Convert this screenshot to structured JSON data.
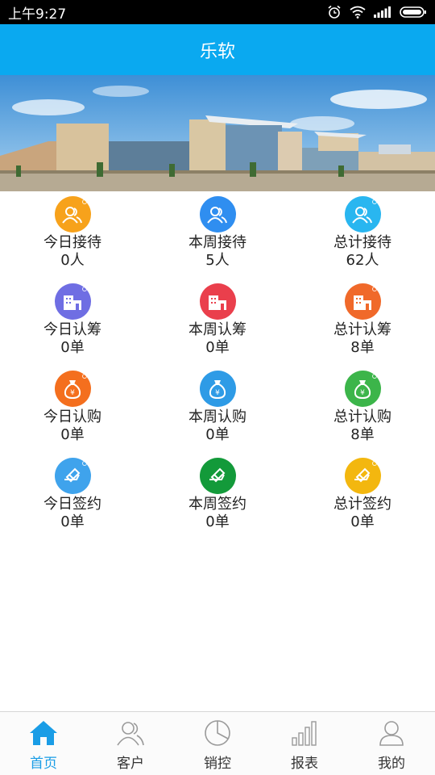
{
  "status_bar": {
    "time": "上午9:27"
  },
  "app_bar": {
    "title": "乐软"
  },
  "colors": {
    "primary": "#0aa9f0",
    "nav_active": "#1a9de6"
  },
  "stats": [
    [
      {
        "icon": "reception-icon",
        "color": "#f7a21b",
        "label": "今日接待",
        "value": "0人"
      },
      {
        "icon": "reception-icon",
        "color": "#2f8ef0",
        "label": "本周接待",
        "value": "5人"
      },
      {
        "icon": "reception-icon",
        "color": "#29b6f0",
        "label": "总计接待",
        "value": "62人"
      }
    ],
    [
      {
        "icon": "building-icon",
        "color": "#6f6ee3",
        "label": "今日认筹",
        "value": "0单"
      },
      {
        "icon": "building-icon",
        "color": "#ea3f4c",
        "label": "本周认筹",
        "value": "0单"
      },
      {
        "icon": "building-icon",
        "color": "#f0692a",
        "label": "总计认筹",
        "value": "8单"
      }
    ],
    [
      {
        "icon": "money-bag-icon",
        "color": "#f46f1e",
        "label": "今日认购",
        "value": "0单"
      },
      {
        "icon": "money-bag-icon",
        "color": "#2e9be6",
        "label": "本周认购",
        "value": "0单"
      },
      {
        "icon": "money-bag-icon",
        "color": "#3cb54a",
        "label": "总计认购",
        "value": "8单"
      }
    ],
    [
      {
        "icon": "signing-icon",
        "color": "#3fa3ec",
        "label": "今日签约",
        "value": "0单"
      },
      {
        "icon": "signing-icon",
        "color": "#139a3a",
        "label": "本周签约",
        "value": "0单"
      },
      {
        "icon": "signing-icon",
        "color": "#f3b70f",
        "label": "总计签约",
        "value": "0单"
      }
    ]
  ],
  "nav": [
    {
      "icon": "home-icon",
      "label": "首页",
      "active": true
    },
    {
      "icon": "customer-icon",
      "label": "客户"
    },
    {
      "icon": "pie-chart-icon",
      "label": "销控"
    },
    {
      "icon": "bar-chart-icon",
      "label": "报表"
    },
    {
      "icon": "user-icon",
      "label": "我的"
    }
  ]
}
